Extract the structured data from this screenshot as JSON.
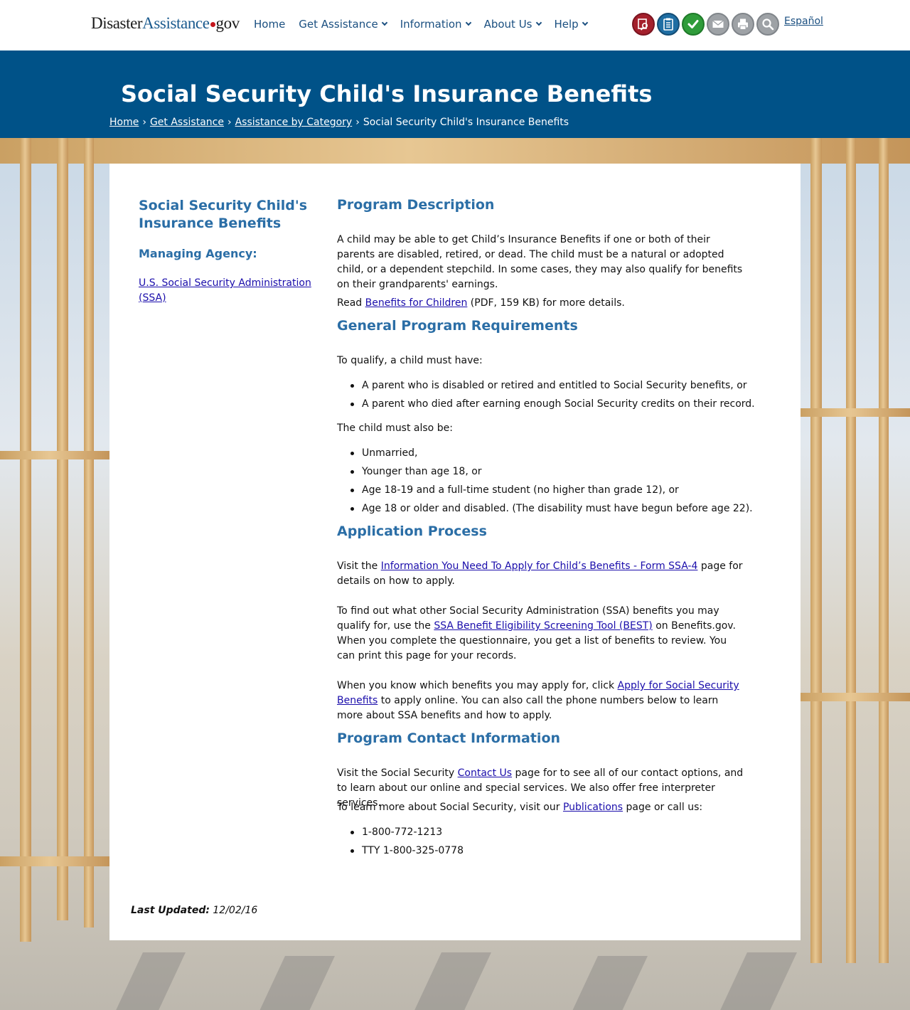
{
  "site": {
    "logo_part1": "Disaster",
    "logo_part2": "Assistance",
    "logo_part3": "gov"
  },
  "nav": [
    {
      "label": "Home"
    },
    {
      "label": "Get Assistance"
    },
    {
      "label": "Information"
    },
    {
      "label": "About Us"
    },
    {
      "label": "Help"
    }
  ],
  "tools": {
    "icons": [
      "find-assistance-icon",
      "checklist-icon",
      "check-status-icon",
      "email-icon",
      "print-icon",
      "search-icon"
    ],
    "language_link": "Español"
  },
  "banner": {
    "title": "Social Security Child's Insurance Benefits",
    "breadcrumb": [
      "Home",
      "Get Assistance",
      "Assistance by Category"
    ],
    "breadcrumb_current": "Social Security Child's Insurance Benefits"
  },
  "sidebar": {
    "title": "Social Security Child's Insurance Benefits",
    "agency_heading": "Managing Agency:",
    "agency_link": "U.S. Social Security Administration (SSA)"
  },
  "program_description": {
    "heading": "Program Description",
    "text": "A child may be able to get Child’s Insurance Benefits if one or both of their parents are disabled, retired, or dead. The child must be a natural or adopted child, or a dependent stepchild. In some cases, they may also qualify for benefits on their grandparents' earnings.",
    "read_prefix": "Read ",
    "read_link": "Benefits for Children",
    "read_suffix": " (PDF, 159 KB) for more details."
  },
  "requirements": {
    "heading": "General Program Requirements",
    "intro": "To qualify, a child must have:",
    "list1": [
      "A parent who is disabled or retired and entitled to Social Security benefits, or",
      "A parent who died after earning enough Social Security credits on their record."
    ],
    "intro2": "The child must also be:",
    "list2": [
      "Unmarried,",
      "Younger than age 18, or",
      "Age 18-19 and a full-time student (no higher than grade 12), or",
      "Age 18 or older and disabled. (The disability must have begun before age 22)."
    ]
  },
  "application": {
    "heading": "Application Process",
    "p1_prefix": "Visit the ",
    "p1_link": "Information You Need To Apply for Child’s Benefits - Form SSA-4",
    "p1_suffix": " page for details on how to apply.",
    "p2_prefix": "To find out what other Social Security Administration (SSA) benefits you may qualify for, use the ",
    "p2_link": "SSA Benefit Eligibility Screening Tool (BEST)",
    "p2_suffix": " on Benefits.gov. When you complete the questionnaire, you get a list of benefits to review. You can print this page for your records.",
    "p3_prefix": "When you know which benefits you may apply for, click ",
    "p3_link": "Apply for Social Security Benefits",
    "p3_suffix": " to apply online. You can also call the phone numbers below to learn more about SSA benefits and how to apply."
  },
  "contact": {
    "heading": "Program Contact Information",
    "p1_prefix": "Visit the Social Security ",
    "p1_link": "Contact Us",
    "p1_suffix": " page for to see all of our contact options, and to learn about our online and special services. We also offer free interpreter services.",
    "p2_prefix": "To learn more about Social Security, visit our ",
    "p2_link": "Publications",
    "p2_suffix": " page or call us:",
    "phones": [
      "1-800-772-1213",
      "TTY 1-800-325-0778"
    ]
  },
  "footer": {
    "updated_label": "Last Updated:",
    "updated_date": "12/02/16"
  },
  "colors": {
    "banner": "#005288",
    "heading": "#2b6ea6",
    "link": "#1a0dab",
    "nav": "#1a4f80"
  }
}
